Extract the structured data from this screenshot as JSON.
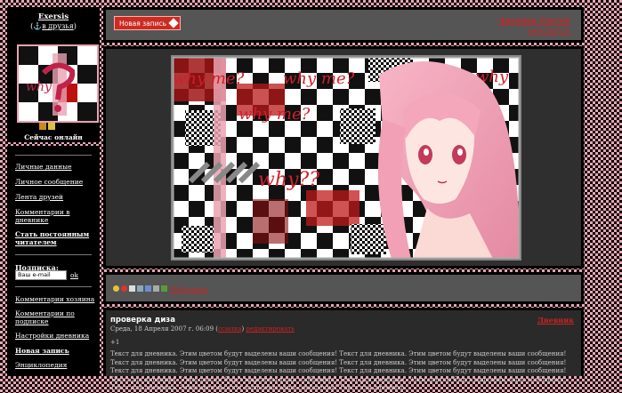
{
  "profile": {
    "username": "Exersis",
    "friends_prefix": "(",
    "friends_link": "в друзья",
    "friends_suffix": ")",
    "online_status": "Сейчас онлайн"
  },
  "sidebar": {
    "items": [
      {
        "label": "Личные данные"
      },
      {
        "label": "Личное сообщение"
      },
      {
        "label": "Лента друзей"
      },
      {
        "label": "Комментарии в дневнике"
      },
      {
        "label": "Стать постоянным читателем"
      }
    ],
    "subscribe_title": "Подписка:",
    "email_placeholder": "Ваш e-mail",
    "ok_label": "ok",
    "items2": [
      {
        "label": "Комментарии хозяина"
      },
      {
        "label": "Комментарии по подписке"
      },
      {
        "label": "Настройки дневника"
      },
      {
        "label": "Новая запись"
      },
      {
        "label": "Энциклопедия"
      }
    ]
  },
  "topbar": {
    "new_post_label": "Новая запись",
    "diary_link": "Дневник Exersis",
    "diary_url": "www.Diary.ru"
  },
  "banner": {
    "texts": [
      "why me?",
      "why me?",
      "why me?",
      "why",
      "why??"
    ]
  },
  "tools": {
    "favorites_label": "Избранное"
  },
  "post": {
    "title": "проверка диза",
    "category": "Дневник",
    "date": "Среда, 18 Апреля 2007 г. 06:09 (",
    "link1": "ссылка",
    "link2": "редактировать",
    "plus": "+1",
    "body": "Текст для дневника. Этим цветом будут выделены ваши сообщения! Текст для дневника. Этим цветом будут выделены ваши сообщения! Текст для дневника. Этим цветом будут выделены ваши сообщения! Текст для дневника. Этим цветом будут выделены ваши сообщения! Текст для дневника. Этим цветом будут выделены ваши сообщения! Текст для дневника. Этим цветом будут выделены ваши сообщения! Текст для дневника. Этим цветом будут выделены ваши сообщения! Текст для дневника. Этим цветом будут выделены ваши сообщения! Текст для дневника. Этим цветом будут выделены ваши сообщения! Текст для дневника."
  },
  "colors": {
    "accent": "#cc2222",
    "pink": "#e9a3b2",
    "panel": "#000000"
  }
}
